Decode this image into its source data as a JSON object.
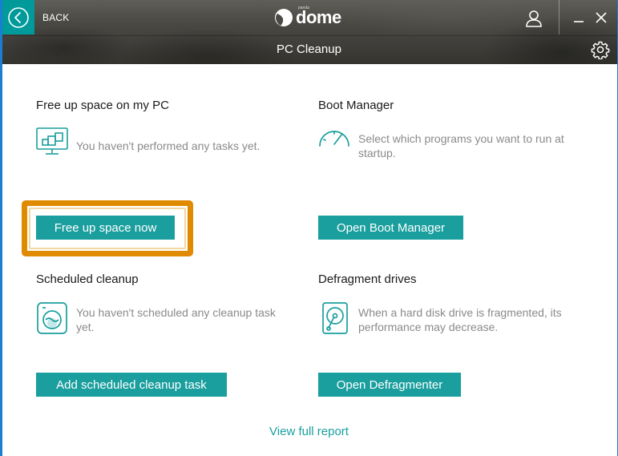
{
  "header": {
    "back_label": "BACK",
    "brand_small": "panda",
    "brand": "dome",
    "page_title": "PC Cleanup"
  },
  "sections": {
    "free_space": {
      "title": "Free up space on my PC",
      "description": "You haven't performed any tasks yet.",
      "button": "Free up space now"
    },
    "boot_manager": {
      "title": "Boot Manager",
      "description_line1": "Select which programs you want to run at",
      "description_line2": "startup.",
      "button": "Open Boot Manager"
    },
    "scheduled": {
      "title": "Scheduled cleanup",
      "description_line1": "You haven't scheduled any cleanup task",
      "description_line2": "yet.",
      "button": "Add scheduled cleanup task"
    },
    "defrag": {
      "title": "Defragment drives",
      "description_line1": "When a hard disk drive is fragmented, its",
      "description_line2": "performance may decrease.",
      "button": "Open Defragmenter"
    }
  },
  "footer": {
    "link": "View full report"
  },
  "colors": {
    "accent": "#1a9e9e",
    "back_button": "#009a9a",
    "highlight": "#e08a00",
    "window_border": "#1b7fd1"
  },
  "icons": {
    "back": "chevron-left-circle",
    "user": "person-outline",
    "minimize": "minus",
    "close": "x",
    "settings": "gear",
    "free_space": "computer-monitor",
    "boot": "speedometer",
    "scheduled": "washing-machine",
    "defrag": "hard-disk"
  }
}
